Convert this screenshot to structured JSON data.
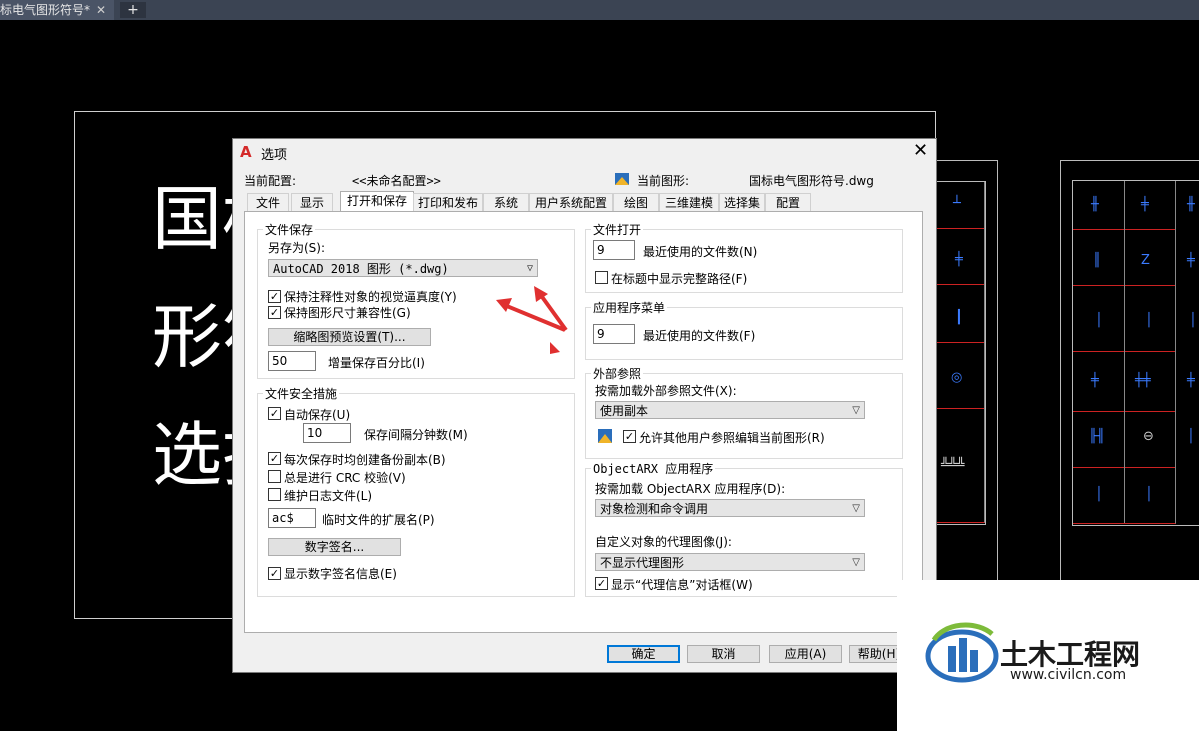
{
  "tabbar": {
    "document_tab": "标电气图形符号*",
    "close_glyph": "✕",
    "new_tab_glyph": "+"
  },
  "drawing": {
    "chars": [
      "国标",
      "形符",
      "选择"
    ],
    "accent_line_color": "#cc2222",
    "symbol_color": "#3b7bff"
  },
  "dialog": {
    "title": "选项",
    "current_profile_label": "当前配置:",
    "current_profile_value": "<<未命名配置>>",
    "current_drawing_label": "当前图形:",
    "current_drawing_value": "国标电气图形符号.dwg",
    "tabs": [
      "文件",
      "显示",
      "打开和保存",
      "打印和发布",
      "系统",
      "用户系统配置",
      "绘图",
      "三维建模",
      "选择集",
      "配置"
    ],
    "active_tab": "打开和保存",
    "file_save": {
      "title": "文件保存",
      "save_as_label": "另存为(S):",
      "save_as_value": "AutoCAD 2018 图形 (*.dwg)",
      "maintain_visual_fidelity": "保持注释性对象的视觉逼真度(Y)",
      "maintain_drawing_size": "保持图形尺寸兼容性(G)",
      "thumbnail_button": "缩略图预览设置(T)...",
      "incremental_value": "50",
      "incremental_label": "增量保存百分比(I)"
    },
    "file_safety": {
      "title": "文件安全措施",
      "autosave": "自动保存(U)",
      "minutes_value": "10",
      "minutes_label": "保存间隔分钟数(M)",
      "backup_copy": "每次保存时均创建备份副本(B)",
      "crc": "总是进行 CRC 校验(V)",
      "log_file": "维护日志文件(L)",
      "ext_value": "ac$",
      "ext_label": "临时文件的扩展名(P)",
      "digital_sig_button": "数字签名...",
      "show_sig_info": "显示数字签名信息(E)"
    },
    "file_open": {
      "title": "文件打开",
      "recent_value": "9",
      "recent_label": "最近使用的文件数(N)",
      "full_path": "在标题中显示完整路径(F)"
    },
    "app_menu": {
      "title": "应用程序菜单",
      "recent_value": "9",
      "recent_label": "最近使用的文件数(F)"
    },
    "xref": {
      "title": "外部参照",
      "demand_load_label": "按需加载外部参照文件(X):",
      "demand_load_value": "使用副本",
      "allow_edit": "允许其他用户参照编辑当前图形(R)"
    },
    "objectarx": {
      "title": "ObjectARX 应用程序",
      "demand_load_label": "按需加载 ObjectARX 应用程序(D):",
      "demand_load_value": "对象检测和命令调用",
      "proxy_label": "自定义对象的代理图像(J):",
      "proxy_value": "不显示代理图形",
      "show_proxy_dialog": "显示“代理信息”对话框(W)"
    },
    "buttons": {
      "ok": "确定",
      "cancel": "取消",
      "apply": "应用(A)",
      "help": "帮助(H)"
    }
  },
  "watermark": {
    "name": "土木工程网",
    "url": "www.civilcn.com"
  },
  "colors": {
    "tabbar": "#3b4453",
    "accent_blue": "#0078d7",
    "arrow_red": "#e03030"
  }
}
